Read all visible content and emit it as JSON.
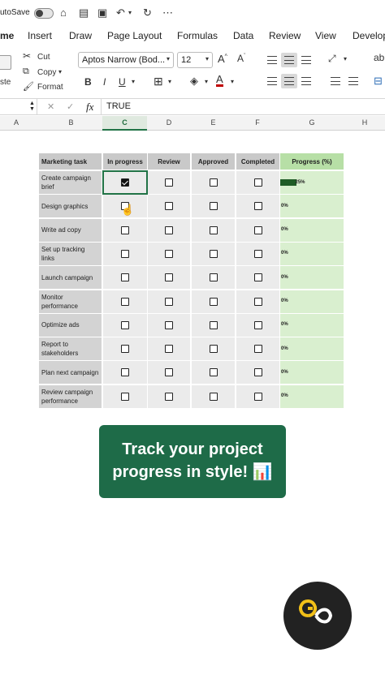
{
  "qat": {
    "autosave": "utoSave"
  },
  "tabs": [
    {
      "label": "me",
      "active": true
    },
    {
      "label": "Insert"
    },
    {
      "label": "Draw"
    },
    {
      "label": "Page Layout"
    },
    {
      "label": "Formulas"
    },
    {
      "label": "Data"
    },
    {
      "label": "Review"
    },
    {
      "label": "View"
    },
    {
      "label": "Develop"
    }
  ],
  "ribbon": {
    "cut": "Cut",
    "copy": "Copy",
    "format": "Format",
    "paste": "ste",
    "font": "Aptos Narrow (Bod...",
    "size": "12"
  },
  "formula_bar": {
    "value": "TRUE",
    "fx": "fx"
  },
  "columns": [
    "A",
    "B",
    "C",
    "D",
    "E",
    "F",
    "G",
    "H"
  ],
  "table": {
    "headers": [
      "Marketing task",
      "In progress",
      "Review",
      "Approved",
      "Completed",
      "Progress (%)"
    ],
    "rows": [
      {
        "task": "Create campaign brief",
        "checks": [
          true,
          false,
          false,
          false
        ],
        "progress": 25,
        "label": "25%"
      },
      {
        "task": "Design graphics",
        "checks": [
          false,
          false,
          false,
          false
        ],
        "progress": 0,
        "label": "0%"
      },
      {
        "task": "Write ad copy",
        "checks": [
          false,
          false,
          false,
          false
        ],
        "progress": 0,
        "label": "0%"
      },
      {
        "task": "Set up tracking links",
        "checks": [
          false,
          false,
          false,
          false
        ],
        "progress": 0,
        "label": "0%"
      },
      {
        "task": "Launch campaign",
        "checks": [
          false,
          false,
          false,
          false
        ],
        "progress": 0,
        "label": "0%"
      },
      {
        "task": "Monitor performance",
        "checks": [
          false,
          false,
          false,
          false
        ],
        "progress": 0,
        "label": "0%"
      },
      {
        "task": "Optimize ads",
        "checks": [
          false,
          false,
          false,
          false
        ],
        "progress": 0,
        "label": "0%"
      },
      {
        "task": "Report to stakeholders",
        "checks": [
          false,
          false,
          false,
          false
        ],
        "progress": 0,
        "label": "0%"
      },
      {
        "task": "Plan next campaign",
        "checks": [
          false,
          false,
          false,
          false
        ],
        "progress": 0,
        "label": "0%"
      },
      {
        "task": "Review campaign performance",
        "checks": [
          false,
          false,
          false,
          false
        ],
        "progress": 0,
        "label": "0%"
      }
    ]
  },
  "banner": {
    "line1": "Track your project",
    "line2": "progress in style! 📊"
  },
  "colors": {
    "accent": "#1e6b48",
    "progress_fill": "#1f5c26",
    "progress_bg": "#d9efcf",
    "logo_ring": "#f2c018"
  }
}
